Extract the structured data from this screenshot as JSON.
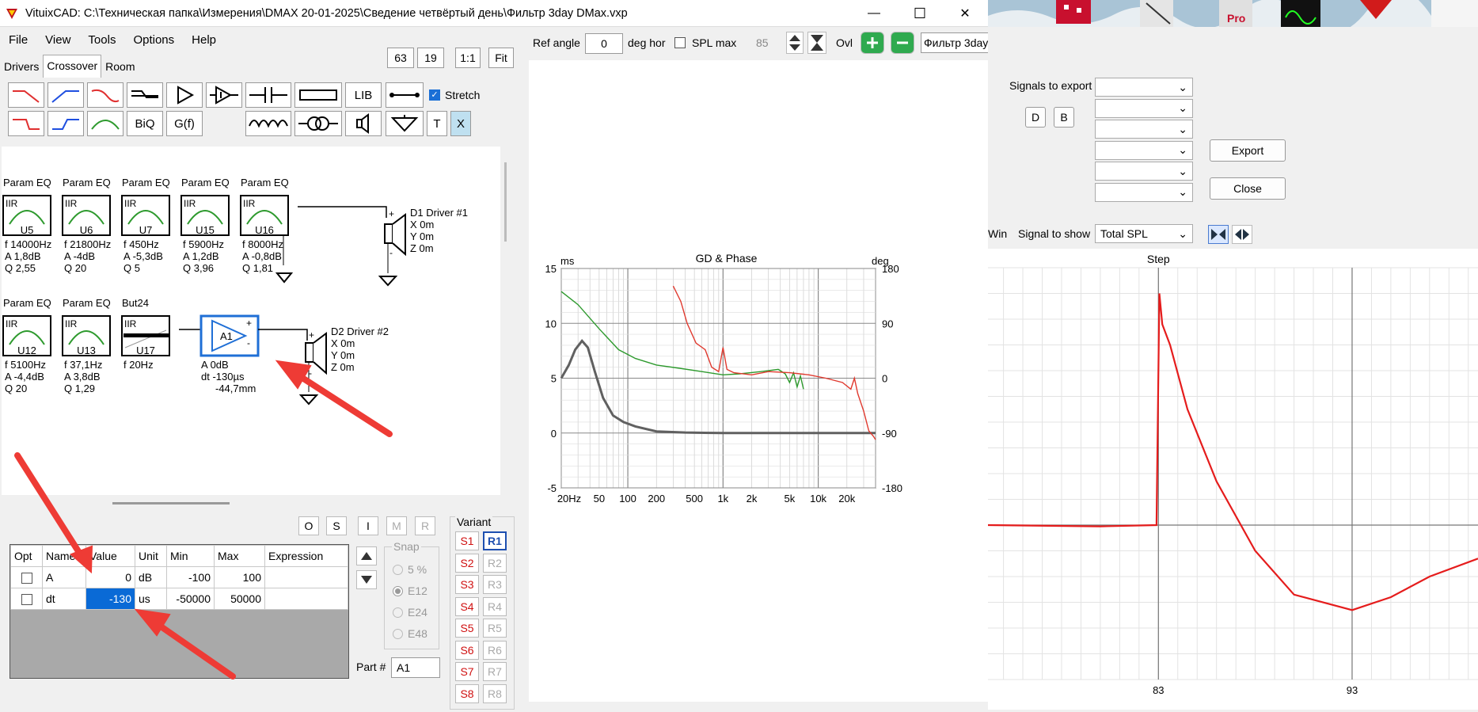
{
  "window": {
    "title": "VituixCAD: C:\\Техническая папка\\Измерения\\DMAX 20-01-2025\\Сведение четвёртый день\\Фильтр 3day DMax.vxp",
    "minimize": "—",
    "maximize": "☐",
    "close": "✕"
  },
  "menu": [
    "File",
    "View",
    "Tools",
    "Options",
    "Help"
  ],
  "tabs": [
    "Drivers",
    "Crossover",
    "Room"
  ],
  "zoom_buttons": [
    "63",
    "19",
    "1:1",
    "Fit"
  ],
  "toolbar": {
    "lib": "LIB",
    "biq": "BiQ",
    "gf": "G(f)",
    "t": "T",
    "x": "X",
    "stretch": "Stretch"
  },
  "schematic": {
    "row1_titles": [
      "Param EQ",
      "Param EQ",
      "Param EQ",
      "Param EQ",
      "Param EQ"
    ],
    "row1_blocks": [
      {
        "type": "IIR",
        "id": "U5",
        "f": "f  14000Hz",
        "a": "A  1,8dB",
        "q": "Q  2,55"
      },
      {
        "type": "IIR",
        "id": "U6",
        "f": "f  21800Hz",
        "a": "A  -4dB",
        "q": "Q  20"
      },
      {
        "type": "IIR",
        "id": "U7",
        "f": "f  450Hz",
        "a": "A  -5,3dB",
        "q": "Q  5"
      },
      {
        "type": "IIR",
        "id": "U15",
        "f": "f  5900Hz",
        "a": "A  1,2dB",
        "q": "Q  3,96"
      },
      {
        "type": "IIR",
        "id": "U16",
        "f": "f  8000Hz",
        "a": "A  -0,8dB",
        "q": "Q  1,81"
      }
    ],
    "driver1": [
      "D1 Driver #1",
      "X 0m",
      "Y 0m",
      "Z 0m"
    ],
    "row2_titles": [
      "Param EQ",
      "Param EQ",
      "But24"
    ],
    "row2_blocks": [
      {
        "type": "IIR",
        "id": "U12",
        "f": "f  5100Hz",
        "a": "A  -4,4dB",
        "q": "Q  20"
      },
      {
        "type": "IIR",
        "id": "U13",
        "f": "f  37,1Hz",
        "a": "A  3,8dB",
        "q": "Q  1,29"
      },
      {
        "type": "IIR",
        "id": "U17",
        "f": "f  20Hz",
        "a": "",
        "q": ""
      }
    ],
    "amp": {
      "id": "A1",
      "a": "A  0dB",
      "dt": "dt -130µs",
      "dist": "-44,7mm"
    },
    "driver2": [
      "D2 Driver #2",
      "X 0m",
      "Y 0m",
      "Z 0m"
    ]
  },
  "osim": [
    "O",
    "S",
    "I",
    "M",
    "R"
  ],
  "params": {
    "headers": [
      "Opt",
      "Name",
      "Value",
      "Unit",
      "Min",
      "Max",
      "Expression"
    ],
    "rows": [
      {
        "name": "A",
        "value": "0",
        "unit": "dB",
        "min": "-100",
        "max": "100",
        "expr": ""
      },
      {
        "name": "dt",
        "value": "-130",
        "unit": "us",
        "min": "-50000",
        "max": "50000",
        "expr": ""
      }
    ]
  },
  "snap": {
    "label": "Snap",
    "options": [
      "5 %",
      "E12",
      "E24",
      "E48"
    ],
    "selected": "E12"
  },
  "variant": {
    "label": "Variant",
    "s": [
      "S1",
      "S2",
      "S3",
      "S4",
      "S5",
      "S6",
      "S7",
      "S8"
    ],
    "r": [
      "R1",
      "R2",
      "R3",
      "R4",
      "R5",
      "R6",
      "R7",
      "R8"
    ]
  },
  "part": {
    "label": "Part #",
    "value": "A1"
  },
  "chart_toolbar": {
    "ref_angle_label": "Ref angle",
    "ref_angle_value": "0",
    "deg_hor": "deg hor",
    "spl_max": "SPL max",
    "spl_value": "85",
    "ovl": "Ovl",
    "filter": "Фильтр 3day"
  },
  "chart_data": [
    {
      "type": "line",
      "title": "GD & Phase",
      "y_left_unit": "ms",
      "y_right_unit": "deg",
      "x_scale": "log",
      "xlim": [
        20,
        40000
      ],
      "ylim_left": [
        -5,
        15
      ],
      "ylim_right": [
        -180,
        180
      ],
      "x_ticks": [
        "20Hz",
        "50",
        "100",
        "200",
        "500",
        "1k",
        "2k",
        "5k",
        "10k",
        "20k"
      ],
      "x_tick_values": [
        20,
        50,
        100,
        200,
        500,
        1000,
        2000,
        5000,
        10000,
        20000
      ],
      "y_left_ticks": [
        "15",
        "10",
        "5",
        "0",
        "-5"
      ],
      "y_right_ticks": [
        "180",
        "90",
        "0",
        "-90",
        "-180"
      ],
      "grid": true,
      "series": [
        {
          "color": "#606060",
          "axis": "left",
          "points": [
            [
              20,
              5
            ],
            [
              24,
              6.2
            ],
            [
              28,
              7.6
            ],
            [
              33,
              8.4
            ],
            [
              38,
              7.8
            ],
            [
              45,
              5.6
            ],
            [
              55,
              3.2
            ],
            [
              70,
              1.6
            ],
            [
              90,
              1.0
            ],
            [
              120,
              0.6
            ],
            [
              200,
              0.15
            ],
            [
              400,
              0.05
            ],
            [
              1000,
              0
            ],
            [
              5000,
              0
            ],
            [
              40000,
              0
            ]
          ]
        },
        {
          "color": "#2e9a2e",
          "axis": "left",
          "points": [
            [
              20,
              12.9
            ],
            [
              30,
              11.7
            ],
            [
              50,
              9.5
            ],
            [
              80,
              7.6
            ],
            [
              120,
              6.8
            ],
            [
              200,
              6.2
            ],
            [
              350,
              5.9
            ],
            [
              600,
              5.6
            ],
            [
              1000,
              5.3
            ],
            [
              1500,
              5.4
            ],
            [
              2500,
              5.6
            ],
            [
              3800,
              5.8
            ],
            [
              4500,
              5.4
            ],
            [
              5000,
              4.6
            ],
            [
              5500,
              5.5
            ],
            [
              6000,
              4.2
            ],
            [
              6500,
              5.2
            ],
            [
              7000,
              4.0
            ]
          ]
        },
        {
          "color": "#e03a2f",
          "axis": "left",
          "points": [
            [
              300,
              13.4
            ],
            [
              360,
              12.0
            ],
            [
              420,
              10.0
            ],
            [
              520,
              8.2
            ],
            [
              650,
              7.6
            ],
            [
              760,
              6.0
            ],
            [
              900,
              5.6
            ],
            [
              1000,
              7.8
            ],
            [
              1100,
              5.8
            ],
            [
              1300,
              5.5
            ],
            [
              2000,
              5.3
            ],
            [
              3000,
              5.6
            ],
            [
              5000,
              5.5
            ],
            [
              8000,
              5.3
            ],
            [
              12000,
              5.0
            ],
            [
              18000,
              4.6
            ],
            [
              22000,
              4.0
            ],
            [
              24000,
              5.0
            ],
            [
              26000,
              3.6
            ],
            [
              30000,
              2.0
            ],
            [
              34000,
              0.2
            ],
            [
              38000,
              -0.3
            ],
            [
              40000,
              -0.6
            ]
          ]
        }
      ]
    },
    {
      "type": "line",
      "title": "Step",
      "x_ticks": [
        "83",
        "93"
      ],
      "x_tick_values": [
        83,
        93
      ],
      "xlim": [
        74.2,
        99.5
      ],
      "ylim": [
        -0.6,
        1.0
      ],
      "grid": true,
      "series": [
        {
          "color": "#e51c1c",
          "points": [
            [
              74.2,
              0.0
            ],
            [
              80,
              -0.005
            ],
            [
              82.9,
              0.0
            ],
            [
              83.05,
              0.9
            ],
            [
              83.2,
              0.78
            ],
            [
              83.6,
              0.7
            ],
            [
              84.5,
              0.45
            ],
            [
              86,
              0.17
            ],
            [
              88,
              -0.1
            ],
            [
              90,
              -0.27
            ],
            [
              93,
              -0.33
            ],
            [
              95,
              -0.28
            ],
            [
              97,
              -0.2
            ],
            [
              99.5,
              -0.13
            ]
          ]
        }
      ]
    }
  ],
  "export_panel": {
    "signals_label": "Signals to export",
    "d": "D",
    "b": "B",
    "export": "Export",
    "close": "Close",
    "win": "Win",
    "signal_to_show_label": "Signal to show",
    "signal_to_show": "Total SPL"
  },
  "taskbar": {
    "pro": "Pro"
  }
}
